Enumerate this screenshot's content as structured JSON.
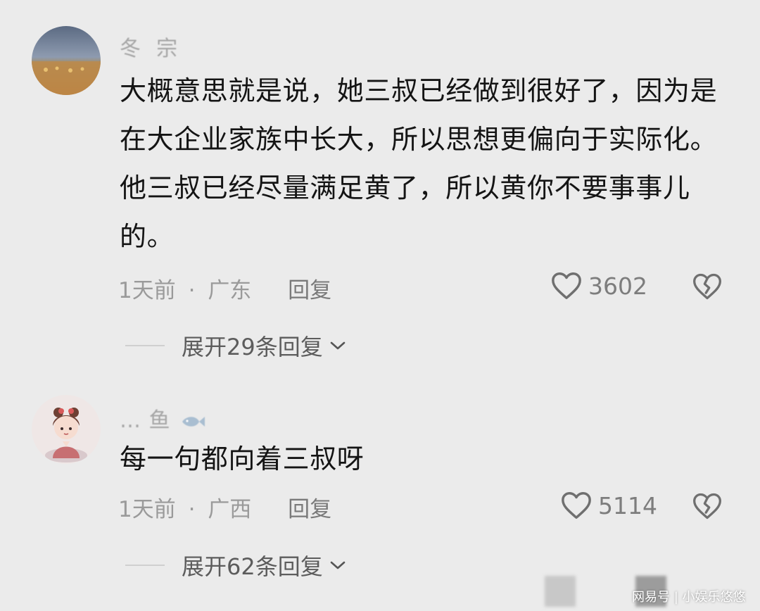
{
  "comments": [
    {
      "username": "冬 ⁠ 宗",
      "text": "大概意思就是说，她三叔已经做到很好了，因为是在大企业家族中长大，所以思想更偏向于实际化。他三叔已经尽量满足黄了，所以黄你不要事事儿的。",
      "time": "1天前",
      "location": "广东",
      "reply_label": "回复",
      "likes": "3602",
      "expand_label": "展开29条回复"
    },
    {
      "username": "… 鱼",
      "text": "每一句都向着三叔呀",
      "time": "1天前",
      "location": "广西",
      "reply_label": "回复",
      "likes": "5114",
      "expand_label": "展开62条回复"
    }
  ],
  "meta_separator": "·",
  "icons": {
    "like": "heart-outline-icon",
    "dislike": "broken-heart-icon",
    "expand": "chevron-down-icon"
  },
  "watermark": "网易号 | 小娱乐悠悠",
  "colors": {
    "background": "#ebebeb",
    "text": "#141414",
    "meta": "#9a9a9a"
  }
}
